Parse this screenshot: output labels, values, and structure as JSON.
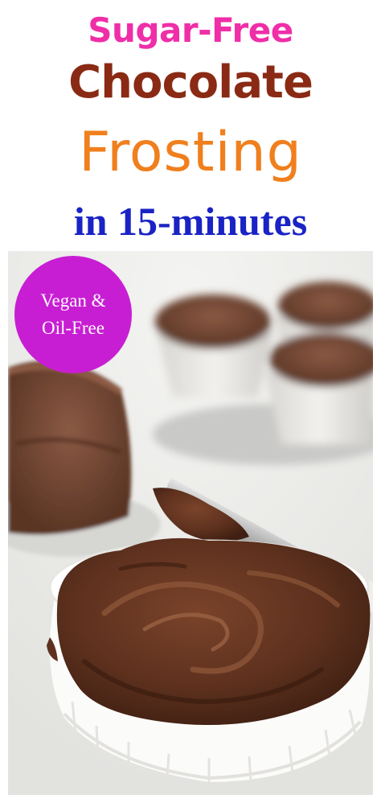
{
  "header": {
    "line1": {
      "text": "Sugar-Free",
      "color": "#ef2ea8"
    },
    "line2": {
      "text": "Chocolate",
      "color": "#8a2a14"
    },
    "line3": {
      "text": "Frosting",
      "color": "#f07f1d"
    },
    "line4": {
      "text": "in 15-minutes",
      "color": "#1a23c4"
    }
  },
  "badge": {
    "line1": "Vegan &",
    "line2": "Oil-Free",
    "color": "#c81ed3"
  },
  "colors": {
    "chocolate_dark": "#4a2416",
    "chocolate_mid": "#6b3a24",
    "chocolate_light": "#8c5538",
    "dish": "#fbfbfa",
    "background": "#ececea"
  }
}
